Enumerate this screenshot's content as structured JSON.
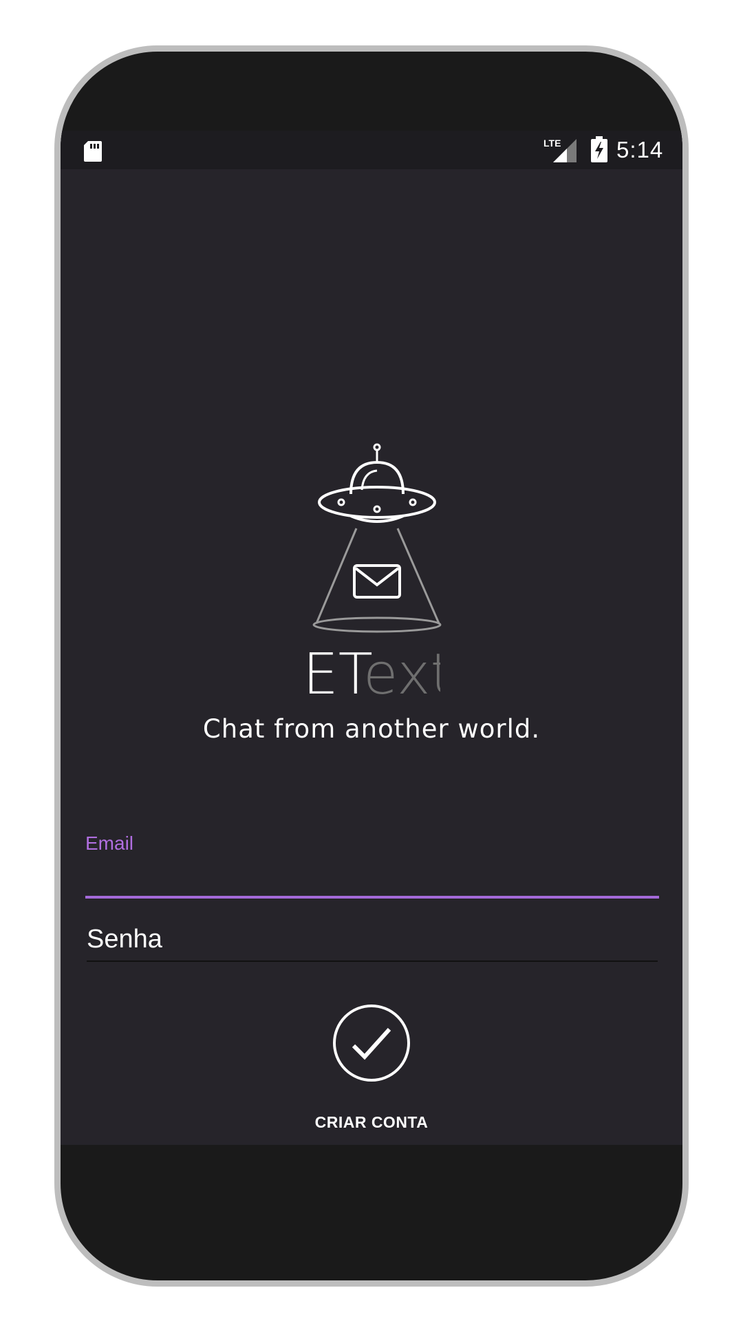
{
  "status_bar": {
    "time": "5:14",
    "network": "LTE",
    "icons": [
      "sd-card-icon",
      "lte-signal-icon",
      "battery-charging-icon"
    ]
  },
  "app": {
    "brand_primary": "ET",
    "brand_secondary": "ext",
    "tagline": "Chat from another world.",
    "logo_icon": "ufo-envelope-icon"
  },
  "form": {
    "email_label": "Email",
    "email_value": "",
    "password_placeholder": "Senha",
    "submit_icon": "checkmark-icon",
    "create_account_label": "CRIAR CONTA"
  },
  "colors": {
    "accent": "#a46ad9",
    "background": "#26242a",
    "frame": "#1a1a1a"
  }
}
